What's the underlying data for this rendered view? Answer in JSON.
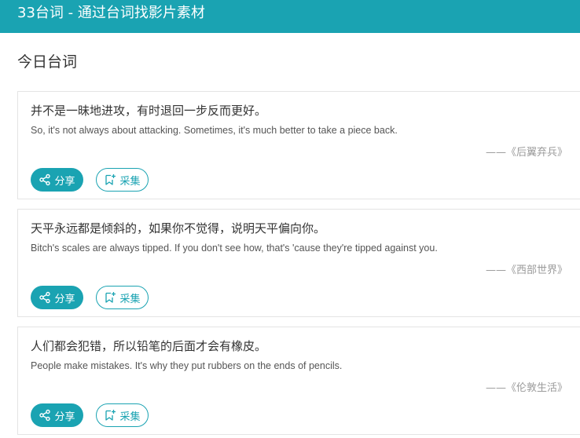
{
  "header": {
    "title": "33台词 - 通过台词找影片素材"
  },
  "section": {
    "title": "今日台词"
  },
  "quotes": [
    {
      "zh": "并不是一昧地进攻，有时退回一步反而更好。",
      "en": "So, it's not always about attacking. Sometimes, it's much better to take a piece back.",
      "source": "——《后翼弃兵》",
      "share_label": "分享",
      "collect_label": "采集"
    },
    {
      "zh": "天平永远都是倾斜的，如果你不觉得，说明天平偏向你。",
      "en": "Bitch's scales are always tipped. If you don't see how, that's 'cause they're tipped against you.",
      "source": "——《西部世界》",
      "share_label": "分享",
      "collect_label": "采集"
    },
    {
      "zh": "人们都会犯错，所以铅笔的后面才会有橡皮。",
      "en": "People make mistakes. It's why they put rubbers on the ends of pencils.",
      "source": "——《伦敦生活》",
      "share_label": "分享",
      "collect_label": "采集"
    }
  ],
  "colors": {
    "accent": "#1aa3b2",
    "text": "#333333",
    "muted": "#9a9a9a",
    "border": "#e4e4e4"
  },
  "icons": {
    "share": "share-icon",
    "collect": "bookmark-plus-icon"
  }
}
